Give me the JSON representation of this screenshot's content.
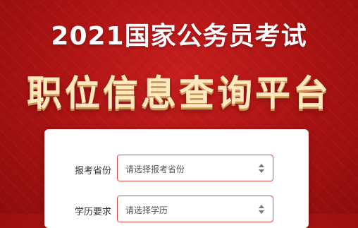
{
  "header": {
    "year_title": "2021国家公务员考试",
    "main_title": "职位信息查询平台"
  },
  "form": {
    "fields": [
      {
        "label": "报考省份",
        "placeholder": "请选择报考省份"
      },
      {
        "label": "学历要求",
        "placeholder": "请选择学历"
      }
    ]
  },
  "colors": {
    "background": "#b01414",
    "title_gold": "#ffe8c0",
    "select_border": "#e04a4a"
  },
  "icons": [
    "select-arrows-icon"
  ]
}
